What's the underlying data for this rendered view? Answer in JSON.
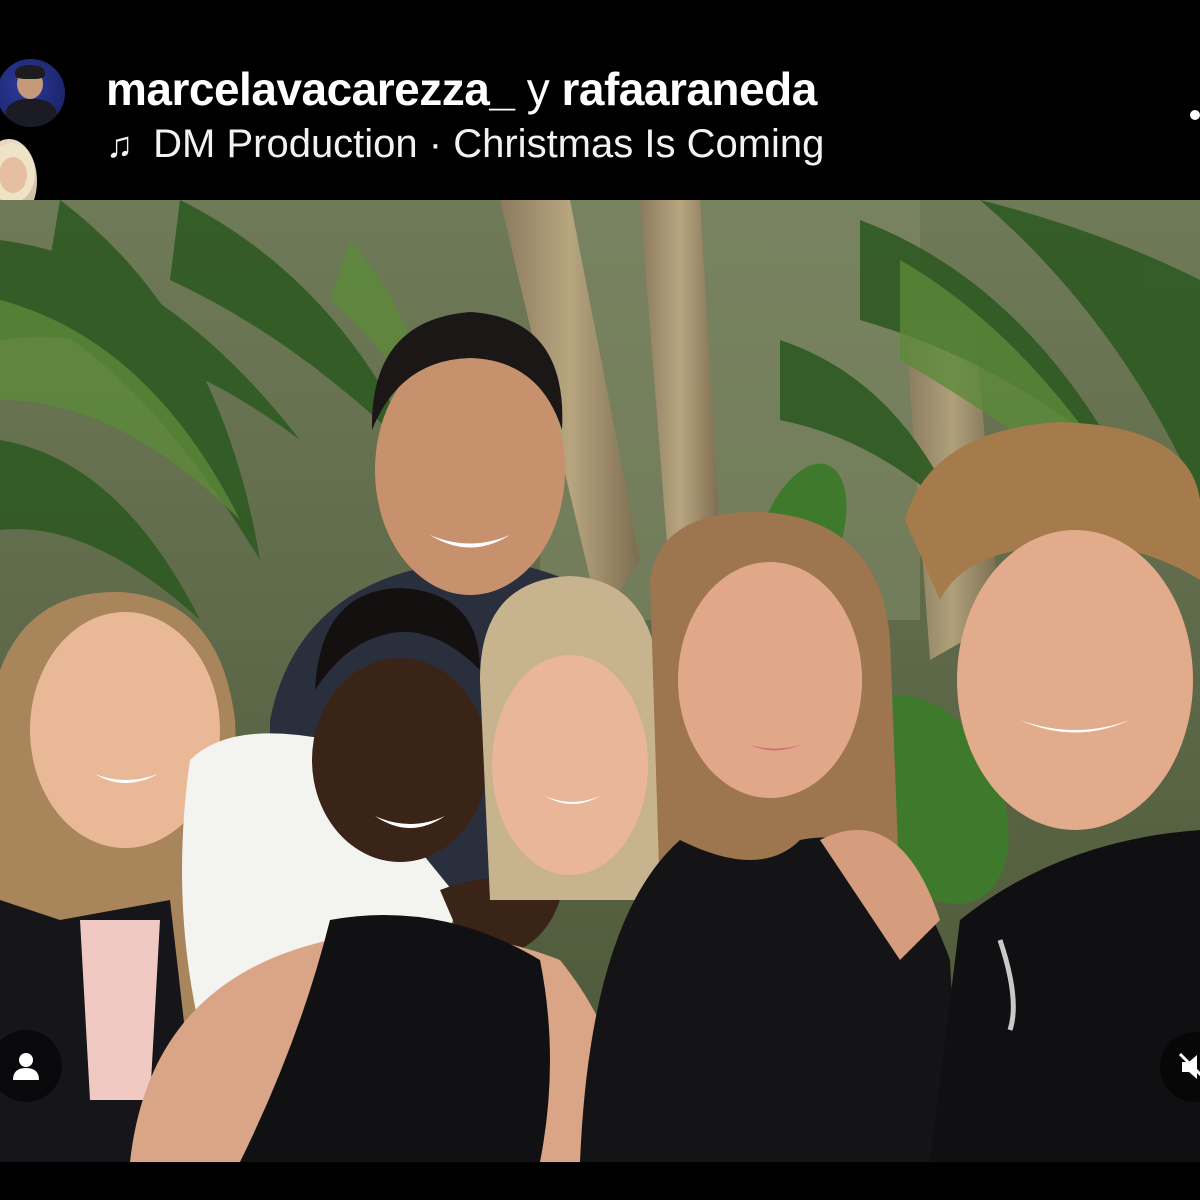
{
  "post": {
    "username_primary": "marcelavacarezza_",
    "conjunction": "y",
    "username_collab": "rafaaraneda",
    "music_icon": "music-note-icon",
    "music_glyph": "♫",
    "music_text": "DM Production · Christmas Is Coming"
  },
  "controls": {
    "tag_people_icon": "person-icon",
    "mute_icon": "speaker-muted-icon"
  },
  "colors": {
    "background": "#000000",
    "text": "#ffffff"
  }
}
